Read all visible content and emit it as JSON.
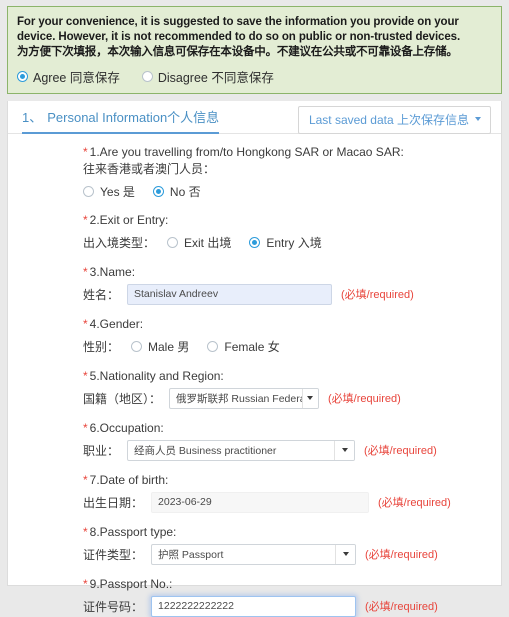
{
  "notice": {
    "line_en_1": "For your convenience, it is suggested to save the information you provide on your",
    "line_en_2": "device. However, it is not recommended to do so on public or non-trusted devices.",
    "line_cn": "为方便下次填报，本次输入信息可保存在本设备中。不建议在公共或不可靠设备上存储。",
    "agree_label": "Agree 同意保存",
    "disagree_label": "Disagree 不同意保存",
    "selected": "agree",
    "bg_color": "#e3edd4",
    "border_color": "#8cb46a"
  },
  "section": {
    "number": "1、",
    "title": "Personal Information个人信息",
    "saved_button": "Last saved data 上次保存信息",
    "accent_color": "#5b9bd5"
  },
  "required_note": "(必填/required)",
  "fields": {
    "q1": {
      "question_en": "1.Are you travelling from/to Hongkong SAR or Macao SAR:",
      "question_cn": "往来香港或者澳门人员：",
      "options": [
        "Yes 是",
        "No 否"
      ],
      "selected": "No 否"
    },
    "q2": {
      "question_en": "2.Exit or Entry:",
      "label_cn": "出入境类型：",
      "options": [
        "Exit 出境",
        "Entry 入境"
      ],
      "selected": "Entry 入境"
    },
    "q3": {
      "question_en": "3.Name:",
      "label_cn": "姓名：",
      "value": "Stanislav Andreev"
    },
    "q4": {
      "question_en": "4.Gender:",
      "label_cn": "性别：",
      "options": [
        "Male 男",
        "Female 女"
      ],
      "selected": ""
    },
    "q5": {
      "question_en": "5.Nationality and Region:",
      "label_cn": "国籍（地区）：",
      "value": "俄罗斯联邦 Russian Federation"
    },
    "q6": {
      "question_en": "6.Occupation:",
      "label_cn": "职业：",
      "value": "经商人员 Business practitioner"
    },
    "q7": {
      "question_en": "7.Date of birth:",
      "label_cn": "出生日期：",
      "value": "2023-06-29"
    },
    "q8": {
      "question_en": "8.Passport type:",
      "label_cn": "证件类型：",
      "value": "护照 Passport"
    },
    "q9": {
      "question_en": "9.Passport No.:",
      "label_cn": "证件号码：",
      "value": "1222222222222"
    }
  }
}
